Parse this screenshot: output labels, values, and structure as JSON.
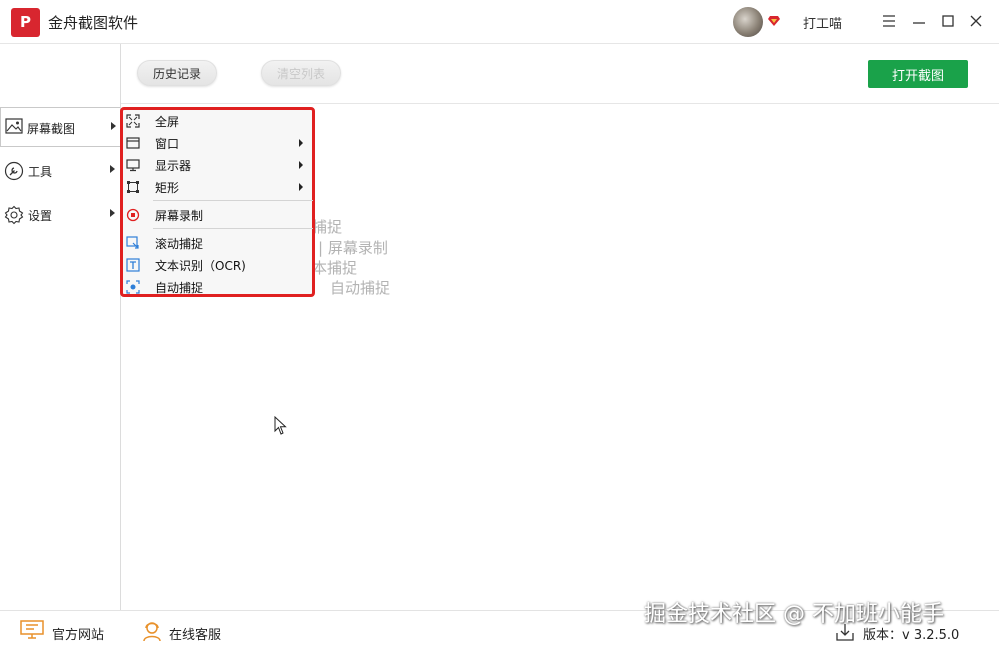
{
  "app": {
    "logo_text": "P",
    "title": "金舟截图软件",
    "username": "打工喵"
  },
  "sidebar": {
    "items": [
      {
        "label": "屏幕截图",
        "icon": "image-icon"
      },
      {
        "label": "工具",
        "icon": "wrench-icon"
      },
      {
        "label": "设置",
        "icon": "gear-icon"
      }
    ]
  },
  "toolbar": {
    "history_label": "历史记录",
    "clear_label": "清空列表",
    "open_label": "打开截图"
  },
  "hints": {
    "line1": "捕捉",
    "line2": "|  屏幕录制",
    "line3": "本捕捉",
    "line4": "自动捕捉"
  },
  "menu": {
    "items": [
      {
        "label": "全屏",
        "icon": "fullscreen-icon",
        "submenu": false
      },
      {
        "label": "窗口",
        "icon": "window-icon",
        "submenu": true
      },
      {
        "label": "显示器",
        "icon": "monitor-icon",
        "submenu": true
      },
      {
        "label": "矩形",
        "icon": "rectangle-icon",
        "submenu": true
      },
      {
        "label": "屏幕录制",
        "icon": "record-icon",
        "submenu": false
      },
      {
        "label": "滚动捕捉",
        "icon": "scroll-capture-icon",
        "submenu": false
      },
      {
        "label": "文本识别（OCR)",
        "icon": "text-ocr-icon",
        "submenu": false
      },
      {
        "label": "自动捕捉",
        "icon": "auto-capture-icon",
        "submenu": false
      }
    ],
    "highlight_color": "#e02020"
  },
  "footer": {
    "website_label": "官方网站",
    "support_label": "在线客服",
    "version_label": "版本：v 3.2.5.0",
    "watermark": "掘金技术社区 @ 不加班小能手"
  },
  "colors": {
    "primary": "#1aa24a",
    "brand": "#d8262f",
    "accent_orange": "#e8912b"
  }
}
